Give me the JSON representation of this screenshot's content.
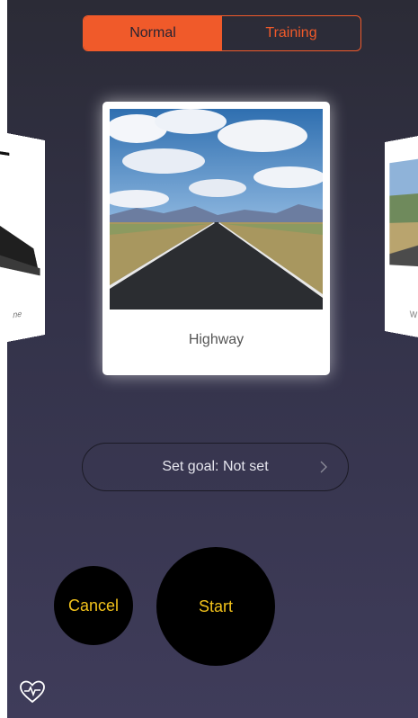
{
  "mode_tabs": [
    {
      "label": "Normal",
      "active": true
    },
    {
      "label": "Training",
      "active": false
    }
  ],
  "carousel": {
    "main_card": {
      "title": "Highway"
    },
    "left_card_caption": "ne",
    "right_card_caption": "W"
  },
  "goal": {
    "label": "Set goal: Not set"
  },
  "buttons": {
    "cancel": "Cancel",
    "start": "Start"
  },
  "icons": {
    "bottom_left": "heart-pulse-icon",
    "goal_arrow": "chevron-right-icon"
  },
  "colors": {
    "accent": "#f05a2a",
    "button_text": "#f2c21b",
    "button_bg": "#000000"
  }
}
